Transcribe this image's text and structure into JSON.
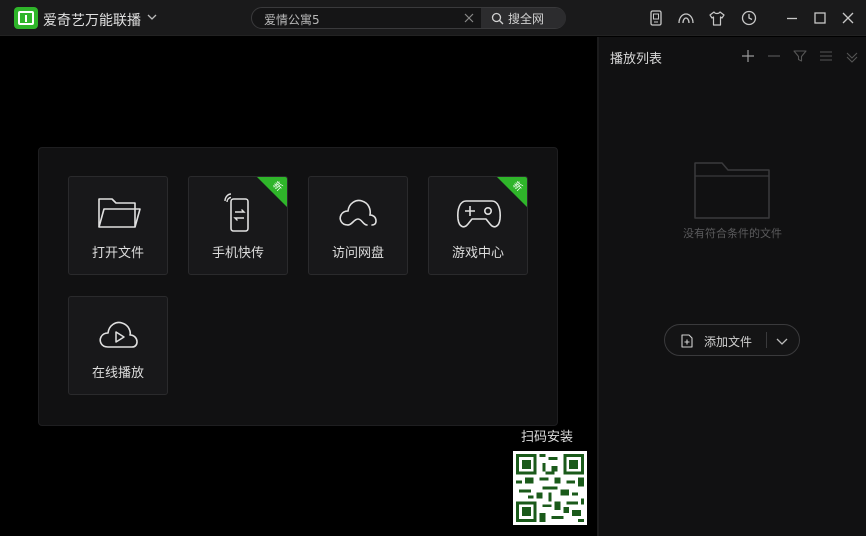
{
  "titlebar": {
    "app_name": "爱奇艺万能联播",
    "search_value": "爱情公寓5",
    "search_button": "搜全网"
  },
  "tiles": [
    {
      "label": "打开文件",
      "icon": "folder-icon",
      "badge": ""
    },
    {
      "label": "手机快传",
      "icon": "phone-transfer-icon",
      "badge": "新"
    },
    {
      "label": "访问网盘",
      "icon": "cloud-icon",
      "badge": ""
    },
    {
      "label": "游戏中心",
      "icon": "gamepad-icon",
      "badge": "新"
    },
    {
      "label": "在线播放",
      "icon": "cloud-play-icon",
      "badge": ""
    }
  ],
  "qr": {
    "label": "扫码安装"
  },
  "playlist": {
    "title": "播放列表",
    "empty_text": "没有符合条件的文件",
    "add_file_label": "添加文件"
  },
  "colors": {
    "accent": "#2fb52a",
    "background": "#000000",
    "panel": "#111112"
  }
}
